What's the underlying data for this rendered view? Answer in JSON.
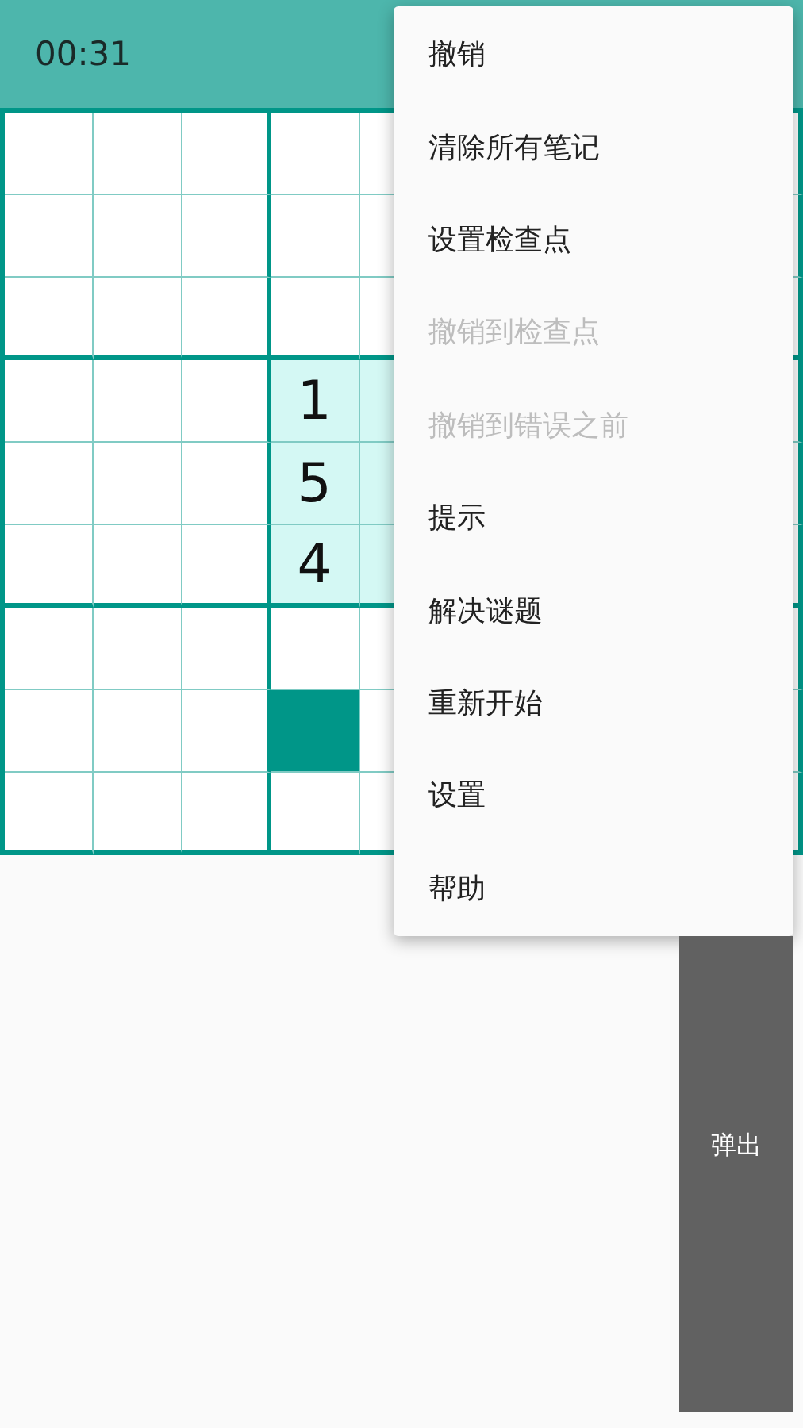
{
  "top_bar": {
    "timer": "00:31"
  },
  "grid": {
    "rows": [
      {
        "cells": [
          {
            "highlighted": false,
            "selected": false
          },
          {
            "highlighted": false,
            "selected": false
          },
          {
            "highlighted": false,
            "selected": false
          },
          {
            "highlighted": false,
            "selected": false
          },
          {
            "highlighted": false,
            "selected": false
          }
        ]
      },
      {
        "cells": [
          {
            "highlighted": false,
            "selected": false
          },
          {
            "highlighted": false,
            "selected": false
          },
          {
            "highlighted": false,
            "selected": false
          },
          {
            "highlighted": false,
            "selected": false
          },
          {
            "highlighted": false,
            "selected": false
          }
        ]
      },
      {
        "cells": [
          {
            "highlighted": false,
            "selected": false
          },
          {
            "highlighted": false,
            "selected": false
          },
          {
            "highlighted": false,
            "selected": false
          },
          {
            "highlighted": false,
            "selected": false
          },
          {
            "highlighted": false,
            "selected": false
          }
        ]
      },
      {
        "cells": [
          {
            "highlighted": false,
            "selected": false
          },
          {
            "highlighted": false,
            "selected": false
          },
          {
            "highlighted": false,
            "selected": false
          },
          {
            "value": "1",
            "highlighted": true,
            "selected": false
          },
          {
            "highlighted": true,
            "selected": false
          }
        ]
      },
      {
        "cells": [
          {
            "highlighted": false,
            "selected": false
          },
          {
            "highlighted": false,
            "selected": false
          },
          {
            "highlighted": false,
            "selected": false
          },
          {
            "value": "5",
            "highlighted": true,
            "selected": false
          },
          {
            "highlighted": true,
            "selected": false
          }
        ]
      },
      {
        "cells": [
          {
            "highlighted": false,
            "selected": false
          },
          {
            "highlighted": false,
            "selected": false
          },
          {
            "highlighted": false,
            "selected": false
          },
          {
            "value": "4",
            "highlighted": true,
            "selected": false
          },
          {
            "highlighted": true,
            "selected": false
          }
        ]
      },
      {
        "cells": [
          {
            "highlighted": false,
            "selected": false
          },
          {
            "highlighted": false,
            "selected": false
          },
          {
            "highlighted": false,
            "selected": false
          },
          {
            "highlighted": false,
            "selected": false
          },
          {
            "highlighted": false,
            "selected": false
          }
        ]
      },
      {
        "cells": [
          {
            "highlighted": false,
            "selected": false
          },
          {
            "highlighted": false,
            "selected": false
          },
          {
            "highlighted": false,
            "selected": false
          },
          {
            "highlighted": false,
            "selected": true
          },
          {
            "highlighted": false,
            "selected": false
          }
        ]
      },
      {
        "cells": [
          {
            "highlighted": false,
            "selected": false
          },
          {
            "highlighted": false,
            "selected": false
          },
          {
            "highlighted": false,
            "selected": false
          },
          {
            "highlighted": false,
            "selected": false
          },
          {
            "highlighted": false,
            "selected": false
          }
        ]
      }
    ]
  },
  "menu": {
    "items": [
      {
        "label": "撤销",
        "disabled": false
      },
      {
        "label": "清除所有笔记",
        "disabled": false
      },
      {
        "label": "设置检查点",
        "disabled": false
      },
      {
        "label": "撤销到检查点",
        "disabled": true
      },
      {
        "label": "撤销到错误之前",
        "disabled": true
      },
      {
        "label": "提示",
        "disabled": false
      },
      {
        "label": "解决谜题",
        "disabled": false
      },
      {
        "label": "重新开始",
        "disabled": false
      },
      {
        "label": "设置",
        "disabled": false
      },
      {
        "label": "帮助",
        "disabled": false
      }
    ]
  },
  "side_button": {
    "label": "弹出"
  }
}
